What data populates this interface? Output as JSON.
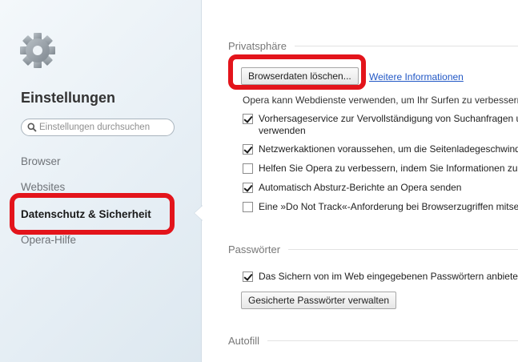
{
  "sidebar": {
    "gear_icon": "gear-icon",
    "title": "Einstellungen",
    "search_placeholder": "Einstellungen durchsuchen",
    "items": [
      {
        "label": "Browser",
        "active": false
      },
      {
        "label": "Websites",
        "active": false
      },
      {
        "label": "Datenschutz & Sicherheit",
        "active": true
      },
      {
        "label": "Opera-Hilfe",
        "active": false
      }
    ]
  },
  "privacy": {
    "title": "Privatsphäre",
    "clear_button": "Browserdaten löschen...",
    "more_info_link": "Weitere Informationen",
    "description": "Opera kann Webdienste verwenden, um Ihr Surfen zu verbessern.",
    "options": [
      {
        "label_line1": "Vorhersageservice zur Vervollständigung von Suchanfragen und URLs",
        "label_line2": "verwenden",
        "checked": true
      },
      {
        "label_line1": "Netzwerkaktionen voraussehen, um die Seitenladegeschwindigkeit zu verbessern",
        "checked": true
      },
      {
        "label_line1": "Helfen Sie Opera zu verbessern, indem Sie Informationen zur Nutzung senden",
        "checked": false
      },
      {
        "label_line1": "Automatisch Absturz-Berichte an Opera senden",
        "checked": true
      },
      {
        "label_line1": "Eine »Do Not Track«-Anforderung bei Browserzugriffen mitsenden",
        "checked": false
      }
    ]
  },
  "passwords": {
    "title": "Passwörter",
    "option": {
      "label": "Das Sichern von im Web eingegebenen Passwörtern anbieten",
      "checked": true
    },
    "manage_button": "Gesicherte Passwörter verwalten"
  },
  "autofill": {
    "title": "Autofill"
  },
  "highlight_color": "#e3141b",
  "link_color": "#2157c5"
}
